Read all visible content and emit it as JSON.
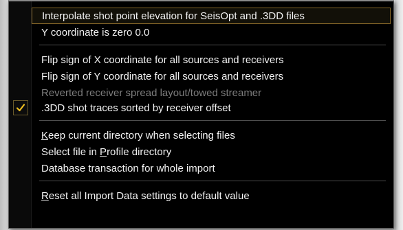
{
  "menu": {
    "items": [
      {
        "label": "Interpolate shot point elevation for SeisOpt and .3DD files",
        "state": "highlighted"
      },
      {
        "label": "Y coordinate is zero 0.0",
        "state": "normal"
      },
      {
        "label": "Flip sign of X coordinate for all sources and receivers",
        "state": "normal"
      },
      {
        "label": "Flip sign of Y coordinate for all sources and receivers",
        "state": "normal"
      },
      {
        "label": "Reverted receiver spread layout/towed streamer",
        "state": "disabled"
      },
      {
        "label": ".3DD shot traces sorted by receiver offset",
        "state": "checked"
      },
      {
        "label_parts": [
          "",
          "K",
          "eep current directory when selecting files"
        ],
        "state": "normal"
      },
      {
        "label_parts": [
          "Select file in ",
          "P",
          "rofile directory"
        ],
        "state": "normal"
      },
      {
        "label": "Database transaction for whole import",
        "state": "normal"
      },
      {
        "label_parts": [
          "",
          "R",
          "eset all Import Data settings to default value"
        ],
        "state": "normal"
      }
    ]
  },
  "icons": {
    "check": "checkmark-icon"
  },
  "colors": {
    "menu_background": "#000000",
    "text": "#f2f2f2",
    "disabled_text": "#7d7d7d",
    "highlight_border": "#8a6a2a",
    "check_color": "#f0c020"
  }
}
